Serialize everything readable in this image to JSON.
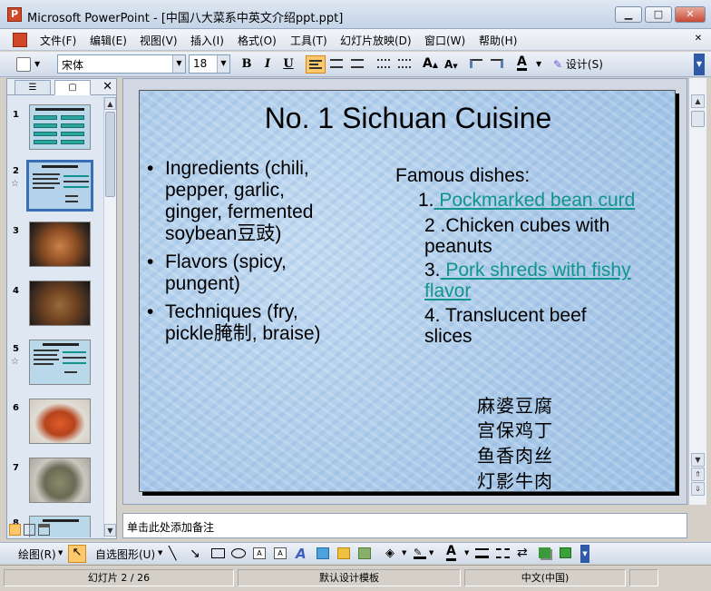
{
  "window": {
    "title": "Microsoft PowerPoint - [中国八大菜系中英文介绍ppt.ppt]",
    "minimize": "▁",
    "maximize": "□",
    "close": "✕"
  },
  "menu": [
    "文件(F)",
    "编辑(E)",
    "视图(V)",
    "插入(I)",
    "格式(O)",
    "工具(T)",
    "幻灯片放映(D)",
    "窗口(W)",
    "帮助(H)"
  ],
  "toolbar": {
    "font_name": "宋体",
    "font_size": "18",
    "bold": "B",
    "italic": "I",
    "underline": "U",
    "design_label": "设计(S)"
  },
  "left_panel": {
    "tab_outline": "☰",
    "tab_slides": "▢",
    "close": "✕",
    "slide_numbers": [
      "1",
      "2",
      "3",
      "4",
      "5",
      "6",
      "7",
      "8"
    ]
  },
  "slide": {
    "title": "No. 1 Sichuan Cuisine",
    "bullets": [
      "Ingredients (chili, pepper, garlic, ginger, fermented soybean豆豉)",
      "Flavors (spicy, pungent)",
      "Techniques  (fry, pickle腌制, braise)"
    ],
    "famous_heading": "Famous dishes:",
    "dishes": [
      {
        "num": "1.",
        "text": " Pockmarked bean curd"
      },
      {
        "num": "2 .",
        "text": "Chicken cubes with peanuts"
      },
      {
        "num": "3.",
        "text": " Pork shreds with fishy flavor"
      },
      {
        "num": "4.",
        "text": " Translucent beef slices"
      }
    ],
    "chinese_names": [
      "麻婆豆腐",
      "宫保鸡丁",
      "鱼香肉丝",
      "灯影牛肉"
    ]
  },
  "notes": {
    "placeholder": "单击此处添加备注"
  },
  "drawing_toolbar": {
    "draw_label": "绘图(R)",
    "autoshapes_label": "自选图形(U)"
  },
  "status": {
    "slide_indicator": "幻灯片 2 / 26",
    "template": "默认设计模板",
    "language": "中文(中国)"
  },
  "colors": {
    "link": "#11948c",
    "slide_bg": "#a8c8e8"
  }
}
